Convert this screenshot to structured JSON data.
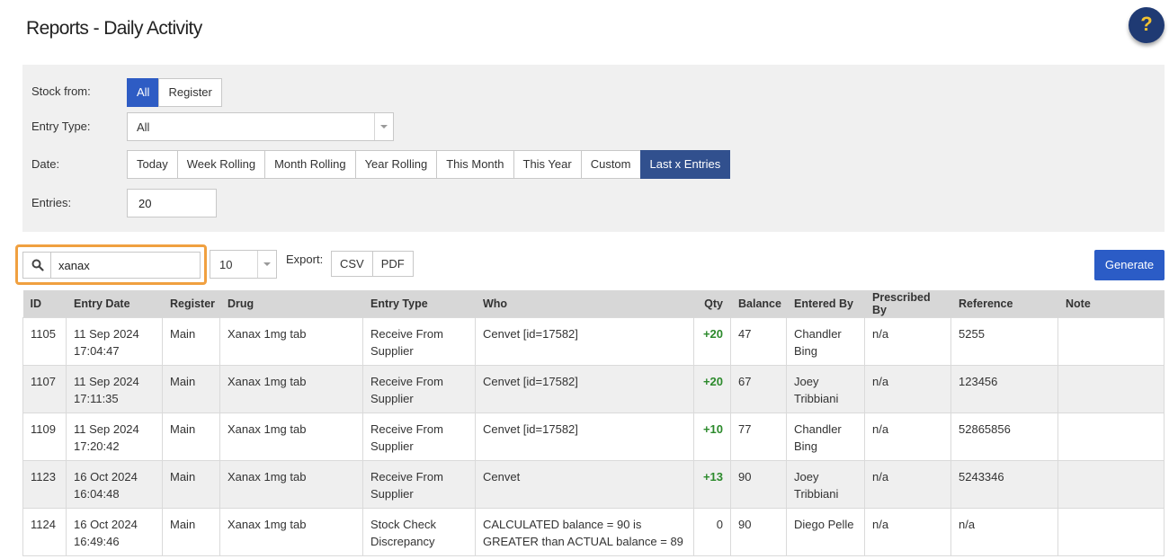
{
  "page": {
    "title": "Reports - Daily Activity",
    "help_label": "?"
  },
  "filters": {
    "stock_from": {
      "label": "Stock from:",
      "options": [
        "All",
        "Register"
      ],
      "selected": "All"
    },
    "entry_type": {
      "label": "Entry Type:",
      "value": "All"
    },
    "date": {
      "label": "Date:",
      "options": [
        "Today",
        "Week Rolling",
        "Month Rolling",
        "Year Rolling",
        "This Month",
        "This Year",
        "Custom",
        "Last x Entries"
      ],
      "selected": "Last x Entries"
    },
    "entries": {
      "label": "Entries:",
      "value": "20"
    }
  },
  "toolbar": {
    "search_value": "xanax",
    "page_size": "10",
    "export_label": "Export:",
    "export_csv": "CSV",
    "export_pdf": "PDF",
    "generate_label": "Generate"
  },
  "table": {
    "columns": [
      "ID",
      "Entry Date",
      "Register",
      "Drug",
      "Entry Type",
      "Who",
      "Qty",
      "Balance",
      "Entered By",
      "Prescribed By",
      "Reference",
      "Note"
    ],
    "rows": [
      {
        "id": "1105",
        "date": "11 Sep 2024",
        "time": "17:04:47",
        "register": "Main",
        "drug": "Xanax 1mg tab",
        "type1": "Receive From",
        "type2": "Supplier",
        "who1": "Cenvet [id=17582]",
        "who2": "",
        "qty": "+20",
        "balance": "47",
        "by1": "Chandler",
        "by2": "Bing",
        "prescribed": "n/a",
        "reference": "5255",
        "note": ""
      },
      {
        "id": "1107",
        "date": "11 Sep 2024",
        "time": "17:11:35",
        "register": "Main",
        "drug": "Xanax 1mg tab",
        "type1": "Receive From",
        "type2": "Supplier",
        "who1": "Cenvet [id=17582]",
        "who2": "",
        "qty": "+20",
        "balance": "67",
        "by1": "Joey",
        "by2": "Tribbiani",
        "prescribed": "n/a",
        "reference": "123456",
        "note": ""
      },
      {
        "id": "1109",
        "date": "11 Sep 2024",
        "time": "17:20:42",
        "register": "Main",
        "drug": "Xanax 1mg tab",
        "type1": "Receive From",
        "type2": "Supplier",
        "who1": "Cenvet [id=17582]",
        "who2": "",
        "qty": "+10",
        "balance": "77",
        "by1": "Chandler",
        "by2": "Bing",
        "prescribed": "n/a",
        "reference": "52865856",
        "note": ""
      },
      {
        "id": "1123",
        "date": "16 Oct 2024",
        "time": "16:04:48",
        "register": "Main",
        "drug": "Xanax 1mg tab",
        "type1": "Receive From",
        "type2": "Supplier",
        "who1": "Cenvet",
        "who2": "",
        "qty": "+13",
        "balance": "90",
        "by1": "Joey",
        "by2": "Tribbiani",
        "prescribed": "n/a",
        "reference": "5243346",
        "note": ""
      },
      {
        "id": "1124",
        "date": "16 Oct 2024",
        "time": "16:49:46",
        "register": "Main",
        "drug": "Xanax 1mg tab",
        "type1": "Stock Check",
        "type2": "Discrepancy",
        "who1": "CALCULATED balance = 90 is",
        "who2": "GREATER than ACTUAL balance = 89",
        "qty": "0",
        "balance": "90",
        "by1": "Diego Pelle",
        "by2": "",
        "prescribed": "n/a",
        "reference": "n/a",
        "note": ""
      }
    ]
  },
  "colors": {
    "accent": "#2e5cc4",
    "active_dark": "#31508e",
    "positive_qty": "#2c8a2c",
    "search_highlight": "#f0a040"
  }
}
